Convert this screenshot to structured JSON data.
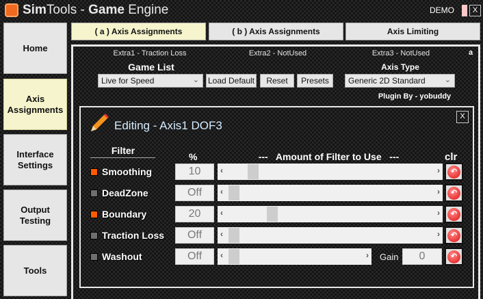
{
  "window": {
    "title_sim": "Sim",
    "title_tools": "Tools - ",
    "title_game": "Game",
    "title_engine": " Engine",
    "demo": "DEMO",
    "close": "X"
  },
  "sidebar": [
    {
      "label": "Home"
    },
    {
      "label": "Axis Assignments"
    },
    {
      "label": "Interface Settings"
    },
    {
      "label": "Output Testing"
    },
    {
      "label": "Tools"
    }
  ],
  "tabs": [
    {
      "label": "( a ) Axis Assignments"
    },
    {
      "label": "( b ) Axis Assignments"
    },
    {
      "label": "Axis Limiting"
    }
  ],
  "main": {
    "extra1": "Extra1 - Traction Loss",
    "extra2": "Extra2 - NotUsed",
    "extra3": "Extra3 - NotUsed",
    "corner": "a",
    "game_list_label": "Game List",
    "game_list_value": "Live for Speed",
    "load_default": "Load Default",
    "reset": "Reset",
    "presets": "Presets",
    "axis_type_label": "Axis Type",
    "axis_type_value": "Generic 2D Standard",
    "plugin_by": "Plugin By - yobuddy"
  },
  "editor": {
    "title": "Editing - Axis1 DOF3",
    "close": "X",
    "filter_header": "Filter",
    "pct_header": "%",
    "amount_header": "---   Amount of Filter to Use   ---",
    "clr_header": "clr",
    "gain_label": "Gain",
    "gain_value": "0",
    "rows": [
      {
        "label": "Smoothing",
        "value": "10",
        "enabled": true,
        "slider": 0.1
      },
      {
        "label": "DeadZone",
        "value": "Off",
        "enabled": false,
        "slider": 0
      },
      {
        "label": "Boundary",
        "value": "20",
        "enabled": true,
        "slider": 0.2
      },
      {
        "label": "Traction Loss",
        "value": "Off",
        "enabled": false,
        "slider": 0
      },
      {
        "label": "Washout",
        "value": "Off",
        "enabled": false,
        "slider": 0
      }
    ]
  },
  "colors": {
    "on": "#ff5a00",
    "off": "#6e6e6e"
  }
}
